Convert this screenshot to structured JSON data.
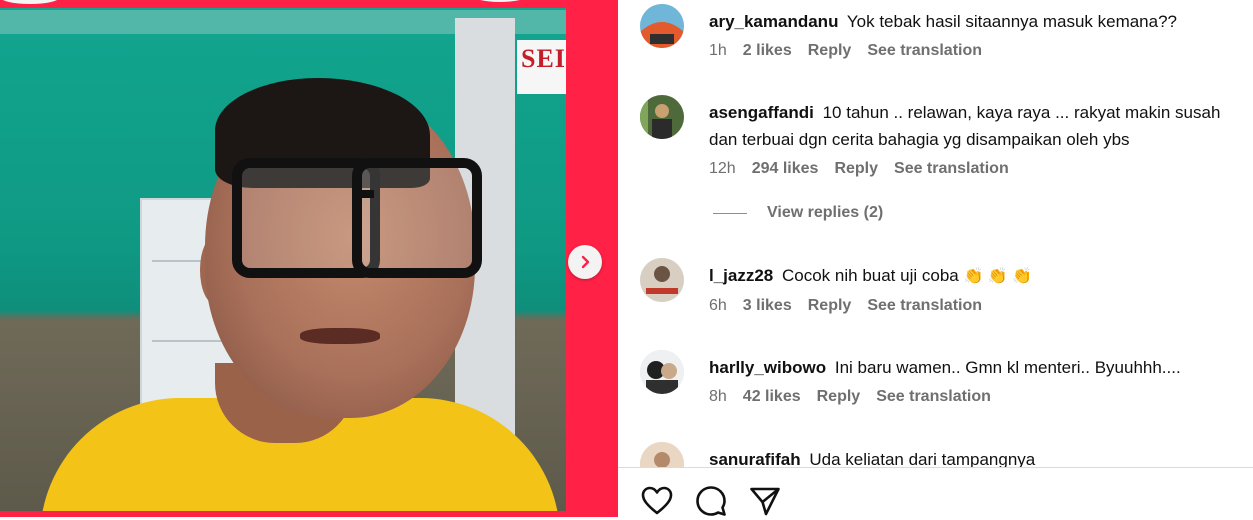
{
  "post": {
    "comments": [
      {
        "username": "ary_kamandanu",
        "text": "Yok tebak hasil sitaannya masuk kemana??",
        "time": "1h",
        "likes": "2 likes",
        "reply_label": "Reply",
        "translate_label": "See translation"
      },
      {
        "username": "asengaffandi",
        "text": "10 tahun .. relawan, kaya raya ... rakyat makin susah dan terbuai dgn cerita bahagia yg disampaikan oleh ybs",
        "time": "12h",
        "likes": "294 likes",
        "reply_label": "Reply",
        "translate_label": "See translation",
        "view_replies": "View replies (2)"
      },
      {
        "username": "l_jazz28",
        "text": "Cocok nih buat uji coba",
        "emoji": "👏 👏 👏",
        "time": "6h",
        "likes": "3 likes",
        "reply_label": "Reply",
        "translate_label": "See translation"
      },
      {
        "username": "harlly_wibowo",
        "text": "Ini baru wamen.. Gmn kl menteri.. Byuuhhh....",
        "time": "8h",
        "likes": "42 likes",
        "reply_label": "Reply",
        "translate_label": "See translation"
      },
      {
        "username": "sanurafifah",
        "text": "Uda keliatan dari tampangnya"
      }
    ]
  },
  "media": {
    "sign_text": "SEI",
    "next_icon": "chevron-right-icon"
  },
  "actions": {
    "like_icon": "heart-icon",
    "comment_icon": "comment-icon",
    "share_icon": "paper-plane-icon"
  },
  "colors": {
    "media_background": "#ff2146",
    "shirt": "#f3c417",
    "wall": "#12a58f",
    "meta_text": "#6f6f6f"
  }
}
